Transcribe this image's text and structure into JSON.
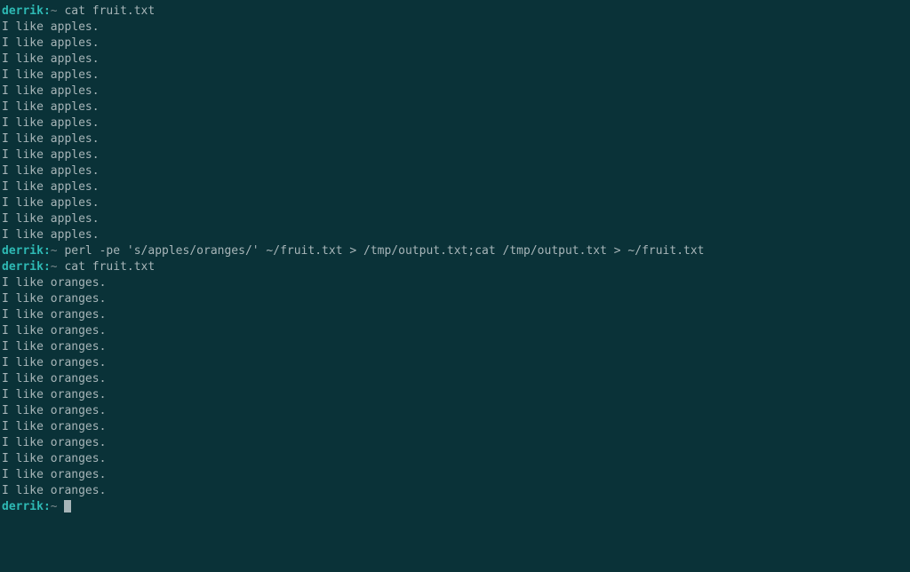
{
  "prompt": {
    "user": "derrik:",
    "path": "~"
  },
  "commands": {
    "cmd1": "cat fruit.txt",
    "cmd2": "perl -pe 's/apples/oranges/' ~/fruit.txt > /tmp/output.txt;cat /tmp/output.txt > ~/fruit.txt",
    "cmd3": "cat fruit.txt"
  },
  "output": {
    "apples_line": "I like apples.",
    "oranges_line": "I like oranges.",
    "apples_count": 14,
    "oranges_count": 14
  }
}
